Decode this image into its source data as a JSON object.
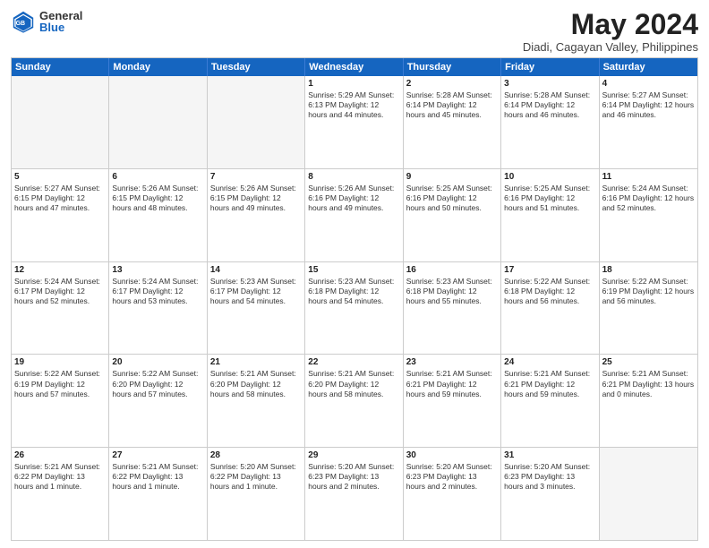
{
  "logo": {
    "general": "General",
    "blue": "Blue"
  },
  "title": {
    "month": "May 2024",
    "location": "Diadi, Cagayan Valley, Philippines"
  },
  "weekdays": [
    "Sunday",
    "Monday",
    "Tuesday",
    "Wednesday",
    "Thursday",
    "Friday",
    "Saturday"
  ],
  "rows": [
    [
      {
        "day": "",
        "info": "",
        "empty": true
      },
      {
        "day": "",
        "info": "",
        "empty": true
      },
      {
        "day": "",
        "info": "",
        "empty": true
      },
      {
        "day": "1",
        "info": "Sunrise: 5:29 AM\nSunset: 6:13 PM\nDaylight: 12 hours\nand 44 minutes."
      },
      {
        "day": "2",
        "info": "Sunrise: 5:28 AM\nSunset: 6:14 PM\nDaylight: 12 hours\nand 45 minutes."
      },
      {
        "day": "3",
        "info": "Sunrise: 5:28 AM\nSunset: 6:14 PM\nDaylight: 12 hours\nand 46 minutes."
      },
      {
        "day": "4",
        "info": "Sunrise: 5:27 AM\nSunset: 6:14 PM\nDaylight: 12 hours\nand 46 minutes."
      }
    ],
    [
      {
        "day": "5",
        "info": "Sunrise: 5:27 AM\nSunset: 6:15 PM\nDaylight: 12 hours\nand 47 minutes."
      },
      {
        "day": "6",
        "info": "Sunrise: 5:26 AM\nSunset: 6:15 PM\nDaylight: 12 hours\nand 48 minutes."
      },
      {
        "day": "7",
        "info": "Sunrise: 5:26 AM\nSunset: 6:15 PM\nDaylight: 12 hours\nand 49 minutes."
      },
      {
        "day": "8",
        "info": "Sunrise: 5:26 AM\nSunset: 6:16 PM\nDaylight: 12 hours\nand 49 minutes."
      },
      {
        "day": "9",
        "info": "Sunrise: 5:25 AM\nSunset: 6:16 PM\nDaylight: 12 hours\nand 50 minutes."
      },
      {
        "day": "10",
        "info": "Sunrise: 5:25 AM\nSunset: 6:16 PM\nDaylight: 12 hours\nand 51 minutes."
      },
      {
        "day": "11",
        "info": "Sunrise: 5:24 AM\nSunset: 6:16 PM\nDaylight: 12 hours\nand 52 minutes."
      }
    ],
    [
      {
        "day": "12",
        "info": "Sunrise: 5:24 AM\nSunset: 6:17 PM\nDaylight: 12 hours\nand 52 minutes."
      },
      {
        "day": "13",
        "info": "Sunrise: 5:24 AM\nSunset: 6:17 PM\nDaylight: 12 hours\nand 53 minutes."
      },
      {
        "day": "14",
        "info": "Sunrise: 5:23 AM\nSunset: 6:17 PM\nDaylight: 12 hours\nand 54 minutes."
      },
      {
        "day": "15",
        "info": "Sunrise: 5:23 AM\nSunset: 6:18 PM\nDaylight: 12 hours\nand 54 minutes."
      },
      {
        "day": "16",
        "info": "Sunrise: 5:23 AM\nSunset: 6:18 PM\nDaylight: 12 hours\nand 55 minutes."
      },
      {
        "day": "17",
        "info": "Sunrise: 5:22 AM\nSunset: 6:18 PM\nDaylight: 12 hours\nand 56 minutes."
      },
      {
        "day": "18",
        "info": "Sunrise: 5:22 AM\nSunset: 6:19 PM\nDaylight: 12 hours\nand 56 minutes."
      }
    ],
    [
      {
        "day": "19",
        "info": "Sunrise: 5:22 AM\nSunset: 6:19 PM\nDaylight: 12 hours\nand 57 minutes."
      },
      {
        "day": "20",
        "info": "Sunrise: 5:22 AM\nSunset: 6:20 PM\nDaylight: 12 hours\nand 57 minutes."
      },
      {
        "day": "21",
        "info": "Sunrise: 5:21 AM\nSunset: 6:20 PM\nDaylight: 12 hours\nand 58 minutes."
      },
      {
        "day": "22",
        "info": "Sunrise: 5:21 AM\nSunset: 6:20 PM\nDaylight: 12 hours\nand 58 minutes."
      },
      {
        "day": "23",
        "info": "Sunrise: 5:21 AM\nSunset: 6:21 PM\nDaylight: 12 hours\nand 59 minutes."
      },
      {
        "day": "24",
        "info": "Sunrise: 5:21 AM\nSunset: 6:21 PM\nDaylight: 12 hours\nand 59 minutes."
      },
      {
        "day": "25",
        "info": "Sunrise: 5:21 AM\nSunset: 6:21 PM\nDaylight: 13 hours\nand 0 minutes."
      }
    ],
    [
      {
        "day": "26",
        "info": "Sunrise: 5:21 AM\nSunset: 6:22 PM\nDaylight: 13 hours\nand 1 minute."
      },
      {
        "day": "27",
        "info": "Sunrise: 5:21 AM\nSunset: 6:22 PM\nDaylight: 13 hours\nand 1 minute."
      },
      {
        "day": "28",
        "info": "Sunrise: 5:20 AM\nSunset: 6:22 PM\nDaylight: 13 hours\nand 1 minute."
      },
      {
        "day": "29",
        "info": "Sunrise: 5:20 AM\nSunset: 6:23 PM\nDaylight: 13 hours\nand 2 minutes."
      },
      {
        "day": "30",
        "info": "Sunrise: 5:20 AM\nSunset: 6:23 PM\nDaylight: 13 hours\nand 2 minutes."
      },
      {
        "day": "31",
        "info": "Sunrise: 5:20 AM\nSunset: 6:23 PM\nDaylight: 13 hours\nand 3 minutes."
      },
      {
        "day": "",
        "info": "",
        "empty": true
      }
    ]
  ]
}
